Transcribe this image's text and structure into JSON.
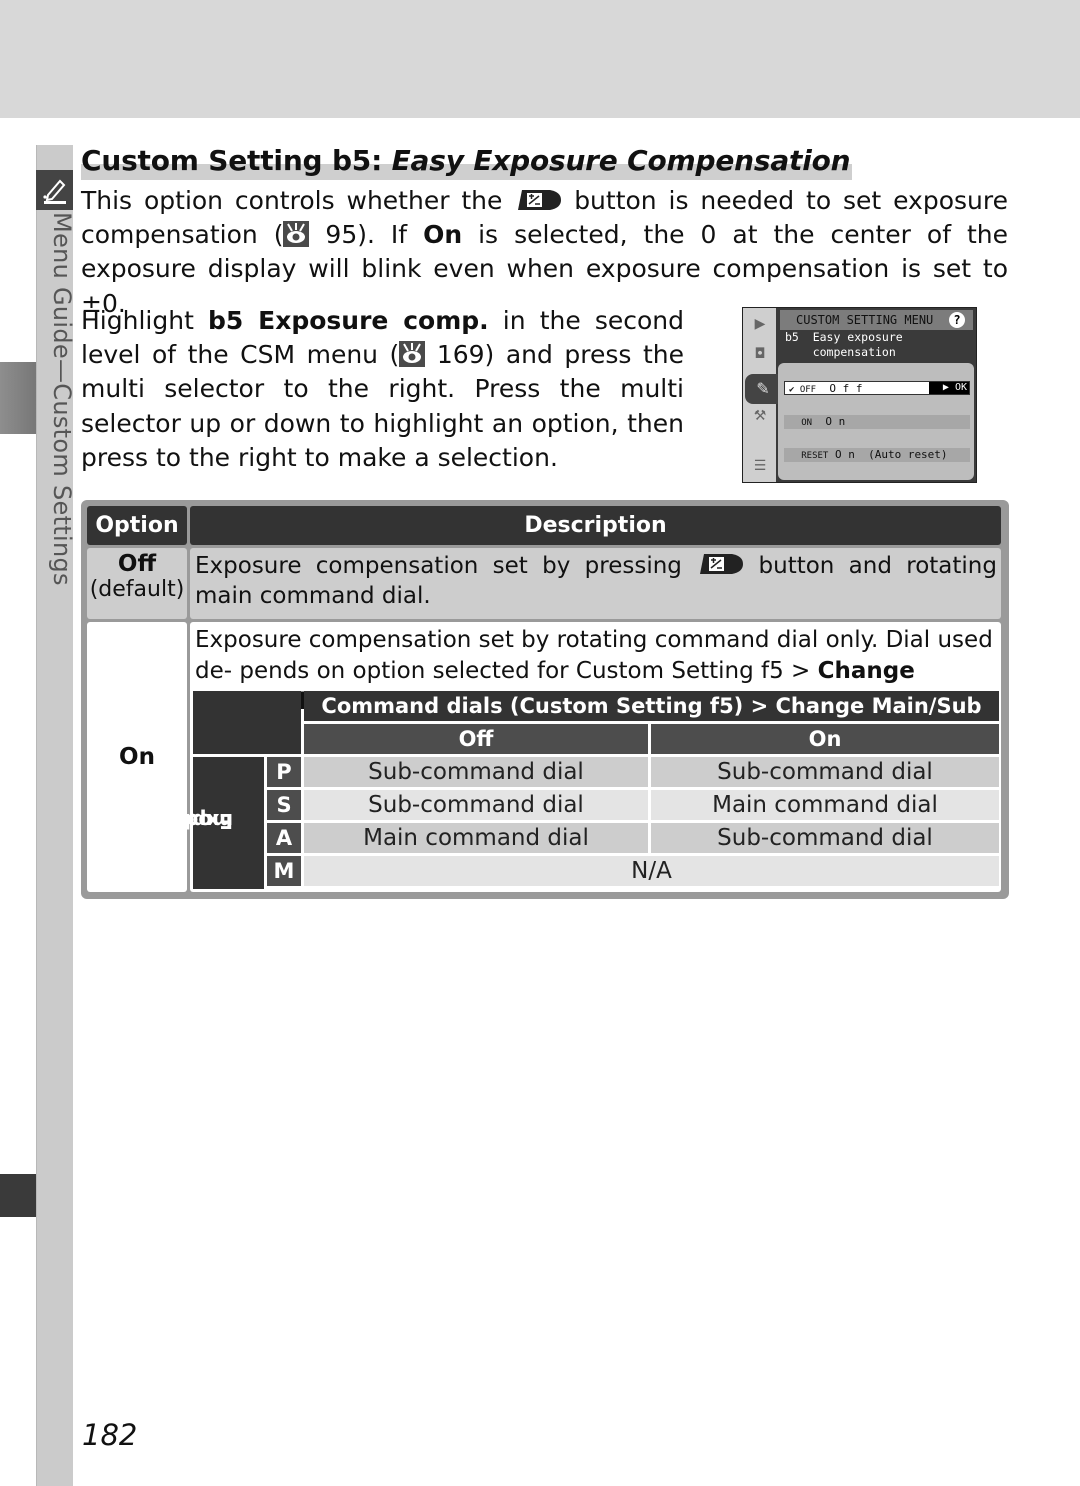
{
  "sidebar": {
    "section_label": "Menu Guide—Custom Settings",
    "section_icon": "pencil-icon"
  },
  "title": {
    "prefix": "Custom Setting b5: ",
    "italic": "Easy Exposure Compensation"
  },
  "intro": {
    "t1": "This option controls whether the ",
    "button_icon": "exposure-compensation-button-icon",
    "t2": " button is needed to set exposure compensation (",
    "ref_icon": "reference-eye-icon",
    "t3": " 95).  If ",
    "bold_on": "On",
    "t4": " is selected, the 0 at the center of the exposure display will blink even when exposure compensation is set to ±0."
  },
  "instructions": {
    "t1": "Highlight ",
    "bold": "b5 Exposure comp.",
    "t2": " in the second level of the CSM menu (",
    "ref_icon": "reference-eye-icon",
    "t3": " 169) and press the multi selector to the right.  Press the multi selector up or down to highlight an option, then press to the right to make a selection."
  },
  "camera_screen": {
    "header": "CUSTOM SETTING MENU",
    "help": "?",
    "item_line1": "b5  Easy exposure",
    "item_line2": "    compensation",
    "options": [
      {
        "code": "✔ OFF",
        "label": "O f f",
        "selected": true,
        "ok": "▶ OK"
      },
      {
        "code": "ON",
        "label": "O n",
        "selected": false
      },
      {
        "code": "RESET",
        "label": "O n  (Auto reset)",
        "selected": false
      }
    ],
    "left_tabs": [
      "playback-icon",
      "camera-icon",
      "pencil-icon",
      "wrench-icon",
      "list-icon"
    ]
  },
  "table": {
    "headers": {
      "option": "Option",
      "description": "Description"
    },
    "rows": [
      {
        "option": "Off",
        "option_note": "(default)",
        "desc_t1": "Exposure compensation set by pressing ",
        "desc_icon": "exposure-compensation-button-icon",
        "desc_t2": " button and rotating main command dial."
      },
      {
        "option": "On",
        "desc_t1": "Exposure compensation set by rotating command dial only.  Dial used de- pends on option selected for Custom Setting f5 > ",
        "desc_bold": "Change Main/Sub",
        "desc_t2": "."
      }
    ],
    "inner": {
      "header": "Command dials (Custom Setting f5) > Change Main/Sub",
      "columns": [
        "Off",
        "On"
      ],
      "row_group_label_1": "Exposure",
      "row_group_label_2": "mode",
      "rows": [
        {
          "mode": "P",
          "off": "Sub-command dial",
          "on": "Sub-command dial"
        },
        {
          "mode": "S",
          "off": "Sub-command dial",
          "on": "Main command dial"
        },
        {
          "mode": "A",
          "off": "Main command dial",
          "on": "Sub-command dial"
        },
        {
          "mode": "M",
          "merged": "N/A"
        }
      ]
    }
  },
  "page_number": "182"
}
